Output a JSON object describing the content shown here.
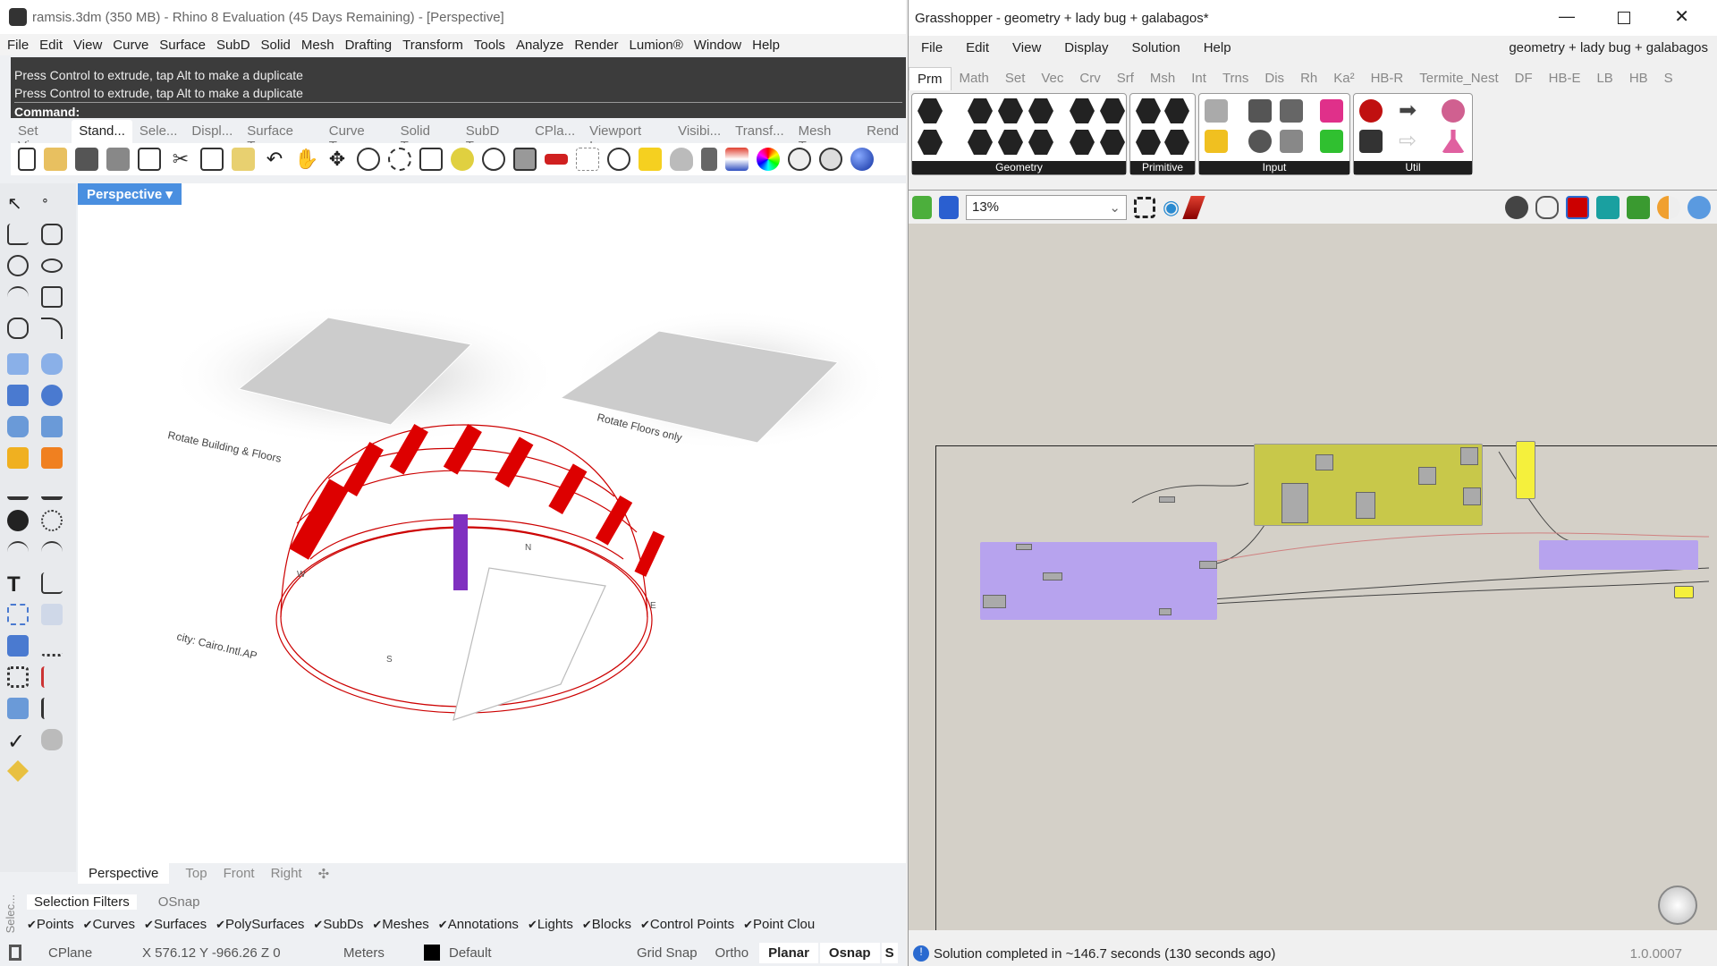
{
  "rhino": {
    "title": "ramsis.3dm (350 MB) - Rhino 8 Evaluation (45 Days Remaining) - [Perspective]",
    "menu": [
      "File",
      "Edit",
      "View",
      "Curve",
      "Surface",
      "SubD",
      "Solid",
      "Mesh",
      "Drafting",
      "Transform",
      "Tools",
      "Analyze",
      "Render",
      "Lumion®",
      "Window",
      "Help"
    ],
    "command_history": [
      "Press Control to extrude, tap Alt to make a duplicate",
      "Press Control to extrude, tap Alt to make a duplicate"
    ],
    "command_prompt": "Command:",
    "toolbar_tabs": [
      "Set Vi...",
      "Stand...",
      "Sele...",
      "Displ...",
      "Surface T...",
      "Curve T...",
      "Solid T...",
      "SubD T...",
      "CPla...",
      "Viewport L...",
      "Visibi...",
      "Transf...",
      "Mesh T...",
      "Rend"
    ],
    "active_toolbar_tab": "Stand...",
    "viewport": {
      "title": "Perspective",
      "labels": [
        "Rotate Building & Floors",
        "Rotate Floors only",
        "city: Cairo.Intl.AP"
      ],
      "compass": [
        "S",
        "E",
        "N",
        "W"
      ]
    },
    "viewport_tabs": [
      "Perspective",
      "Top",
      "Front",
      "Right"
    ],
    "panel_side_label": "Selec...",
    "panel_tabs": [
      "Selection Filters",
      "OSnap"
    ],
    "filters": [
      "Points",
      "Curves",
      "Surfaces",
      "PolySurfaces",
      "SubDs",
      "Meshes",
      "Annotations",
      "Lights",
      "Blocks",
      "Control Points",
      "Point Clou"
    ],
    "status": {
      "cplane": "CPlane",
      "coords": "X 576.12 Y -966.26 Z 0",
      "units": "Meters",
      "layer": "Default",
      "grid_snap": "Grid Snap",
      "ortho": "Ortho",
      "planar": "Planar",
      "osnap": "Osnap",
      "s": "S"
    }
  },
  "grasshopper": {
    "title": "Grasshopper - geometry + lady bug + galabagos*",
    "menu": [
      "File",
      "Edit",
      "View",
      "Display",
      "Solution",
      "Help"
    ],
    "doc_name": "geometry + lady bug + galabagos",
    "tabs": [
      "Prm",
      "Math",
      "Set",
      "Vec",
      "Crv",
      "Srf",
      "Msh",
      "Int",
      "Trns",
      "Dis",
      "Rh",
      "Ka²",
      "HB-R",
      "Termite_Nest",
      "DF",
      "HB-E",
      "LB",
      "HB",
      "S"
    ],
    "ribbon_groups": [
      "Geometry",
      "Primitive",
      "Input",
      "Util"
    ],
    "zoom": "13%",
    "status": "Solution completed in ~146.7 seconds (130 seconds ago)",
    "version": "1.0.0007",
    "colors": {
      "group_olive": "#c8c84a",
      "group_purple": "#b7a3ee",
      "panel_yellow": "#f5f03c",
      "canvas": "#d4d0c8"
    }
  }
}
